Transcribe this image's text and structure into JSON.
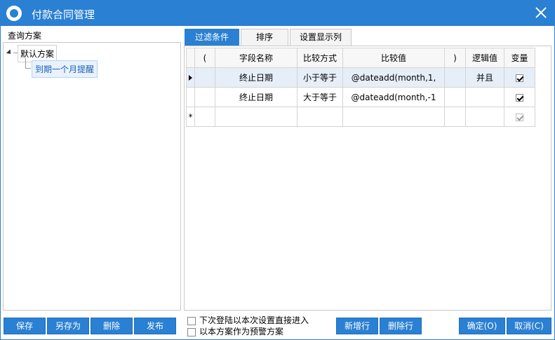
{
  "window": {
    "title": "付款合同管理"
  },
  "left": {
    "label": "查询方案",
    "tree": {
      "root": "默认方案",
      "child": "到期一个月提醒"
    },
    "buttons": {
      "save": "保存",
      "save_as": "另存为",
      "delete": "删除",
      "publish": "发布"
    }
  },
  "tabs": [
    {
      "label": "过滤条件"
    },
    {
      "label": "排序"
    },
    {
      "label": "设置显示列"
    }
  ],
  "grid": {
    "columns": {
      "open": "(",
      "field": "字段名称",
      "op": "比较方式",
      "value": "比较值",
      "close": ")",
      "logic": "逻辑值",
      "var": "变量"
    },
    "rows": [
      {
        "field": "终止日期",
        "op": "小于等于",
        "value": "@dateadd(month,1,",
        "logic": "并且",
        "var": true
      },
      {
        "field": "终止日期",
        "op": "大于等于",
        "value": "@dateadd(month,-1",
        "logic": "",
        "var": true
      }
    ],
    "new_row_marker": "*"
  },
  "options": {
    "direct_enter": "下次登陆以本次设置直接进入",
    "as_warning": "以本方案作为预警方案"
  },
  "actions": {
    "add_row": "新增行",
    "delete_row": "删除行",
    "ok": "确定(O)",
    "cancel": "取消(C)"
  }
}
